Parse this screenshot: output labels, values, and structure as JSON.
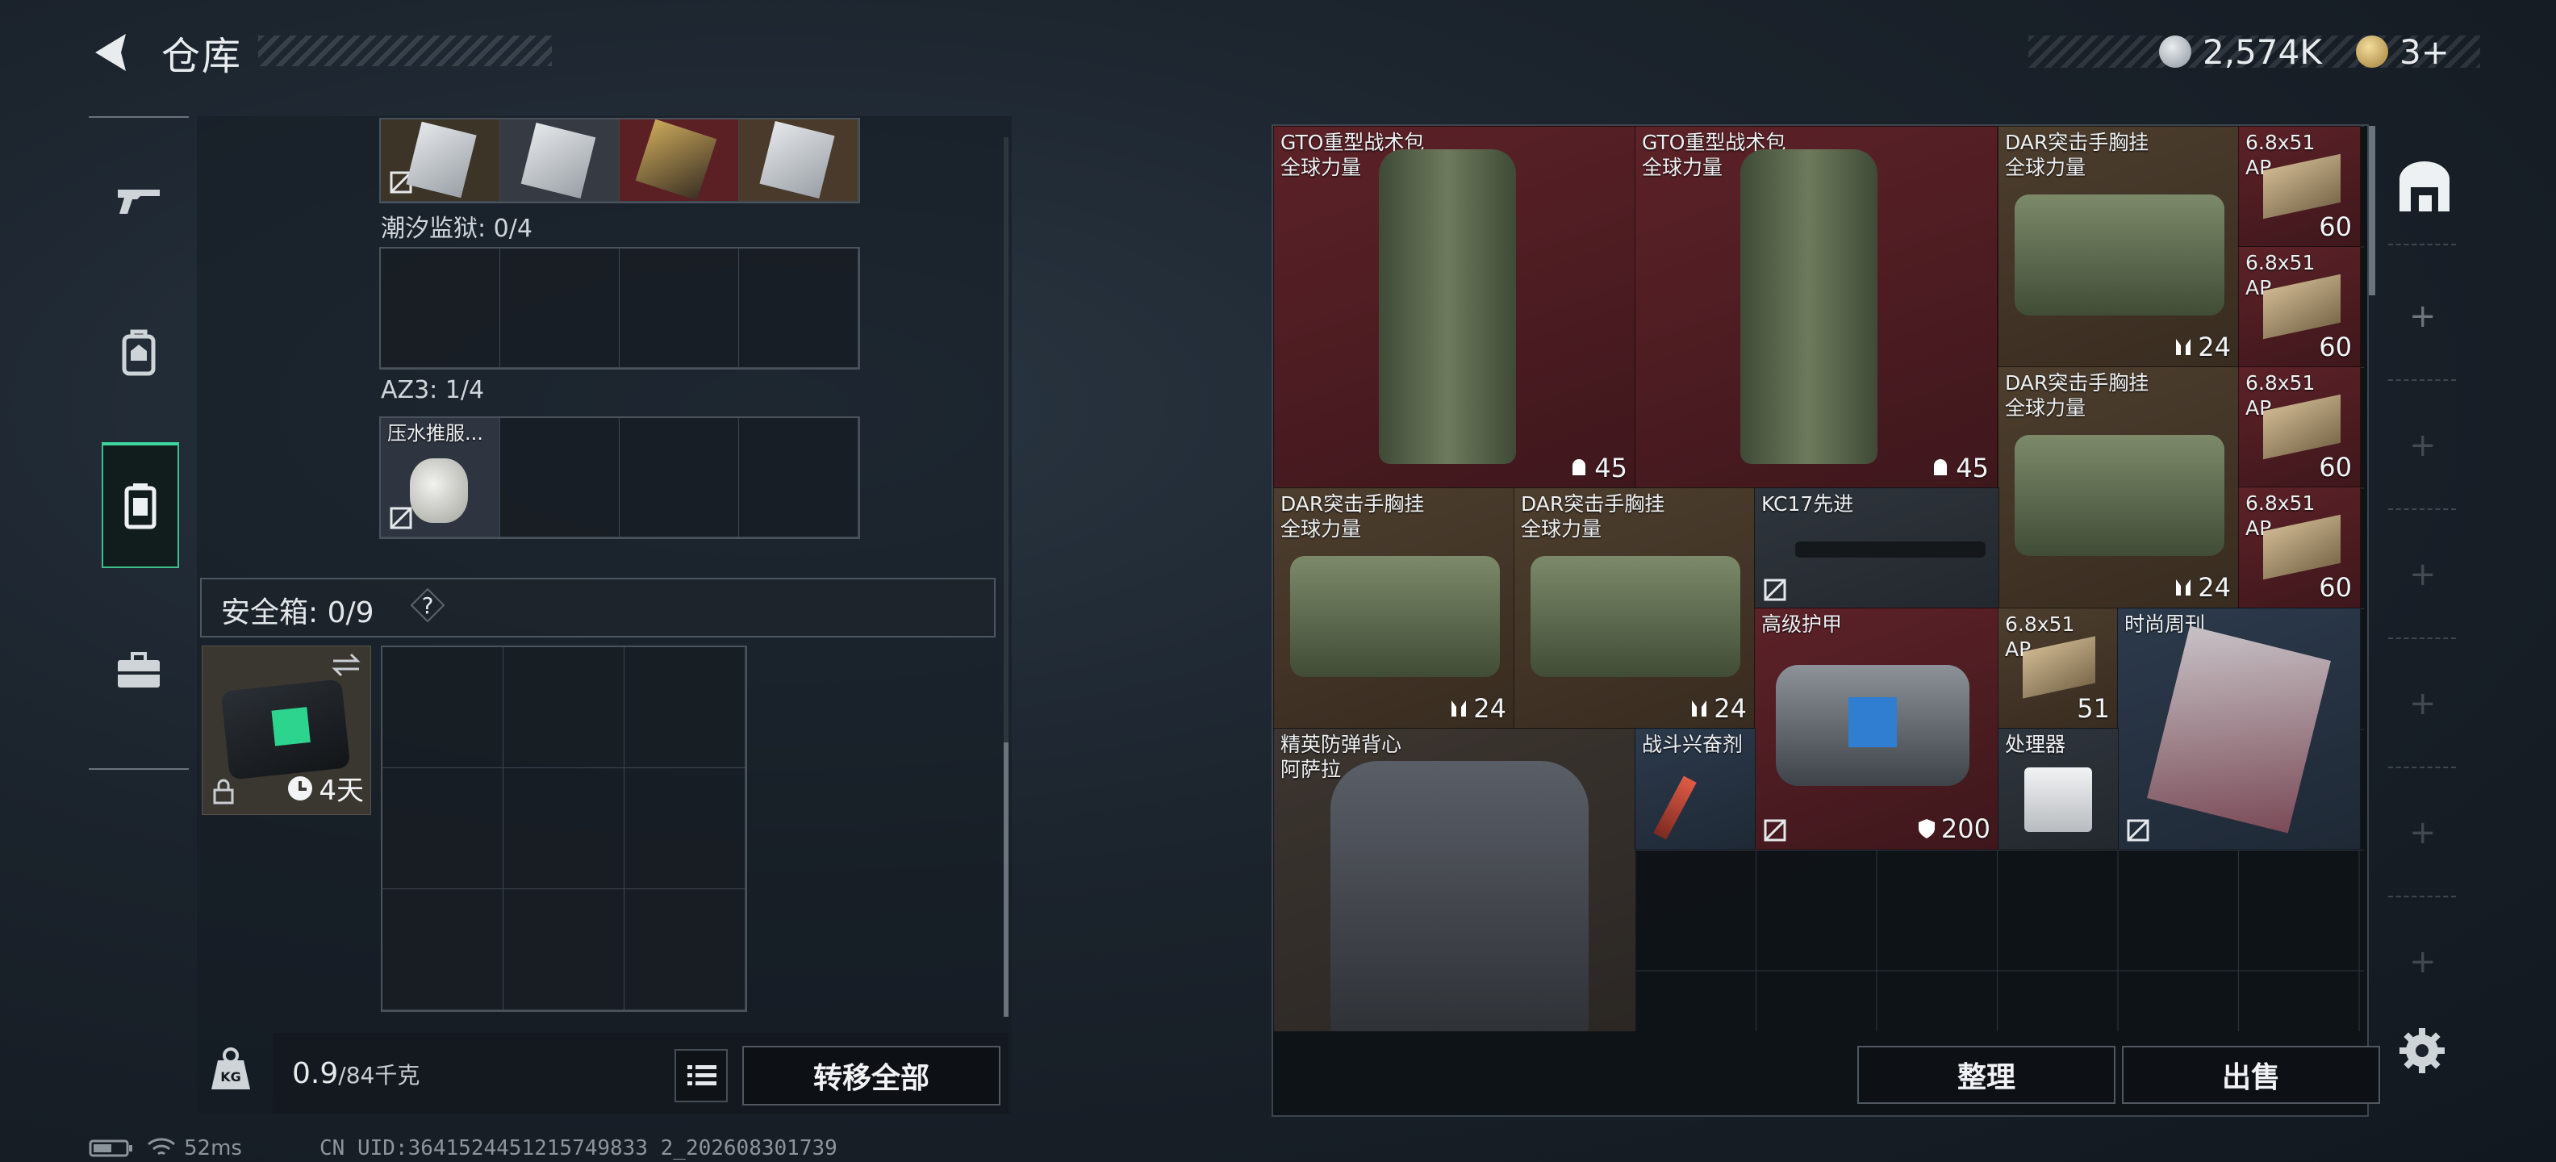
{
  "header": {
    "title": "仓库",
    "currency1": "2,574K",
    "currency2": "3+"
  },
  "left_panel": {
    "prison_label": "潮汐监狱: 0/4",
    "az3_label": "AZ3: 1/4",
    "az3_item": "压水推服...",
    "safe_label": "安全箱: 0/9",
    "safe_help": "?",
    "safe_timer": "4天",
    "weight_value": "0.9",
    "weight_max": "/84千克",
    "transfer_all": "转移全部"
  },
  "inventory": {
    "items": [
      {
        "name": "GTO重型战术包\n全球力量",
        "count": "45"
      },
      {
        "name": "GTO重型战术包\n全球力量",
        "count": "45"
      },
      {
        "name": "DAR突击手胸挂\n全球力量",
        "count": "24"
      },
      {
        "name": "6.8x51\nAP",
        "count": "60"
      },
      {
        "name": "6.8x51\nAP",
        "count": "60"
      },
      {
        "name": "DAR突击手胸挂\n全球力量",
        "count": "24"
      },
      {
        "name": "6.8x51\nAP",
        "count": "60"
      },
      {
        "name": "6.8x51\nAP",
        "count": "60"
      },
      {
        "name": "DAR突击手胸挂\n全球力量",
        "count": "24"
      },
      {
        "name": "DAR突击手胸挂\n全球力量",
        "count": "24"
      },
      {
        "name": "KC17先进",
        "count": ""
      },
      {
        "name": "高级护甲",
        "count": "200"
      },
      {
        "name": "6.8x51\nAP",
        "count": "51"
      },
      {
        "name": "时尚周刊",
        "count": ""
      },
      {
        "name": "精英防弹背心\n阿萨拉",
        "count": ""
      },
      {
        "name": "战斗兴奋剂",
        "count": ""
      },
      {
        "name": "处理器",
        "count": ""
      }
    ]
  },
  "actions": {
    "organize": "整理",
    "sell": "出售"
  },
  "status": {
    "ping": "52ms",
    "uid": "CN UID:3641524451215749833 2_202608301739"
  },
  "colors": {
    "accent": "#3fd6a0",
    "red_item_bg": "#5c2228",
    "brown_item_bg": "#4d3e2e",
    "blue_item_bg": "#2c3a4c"
  }
}
